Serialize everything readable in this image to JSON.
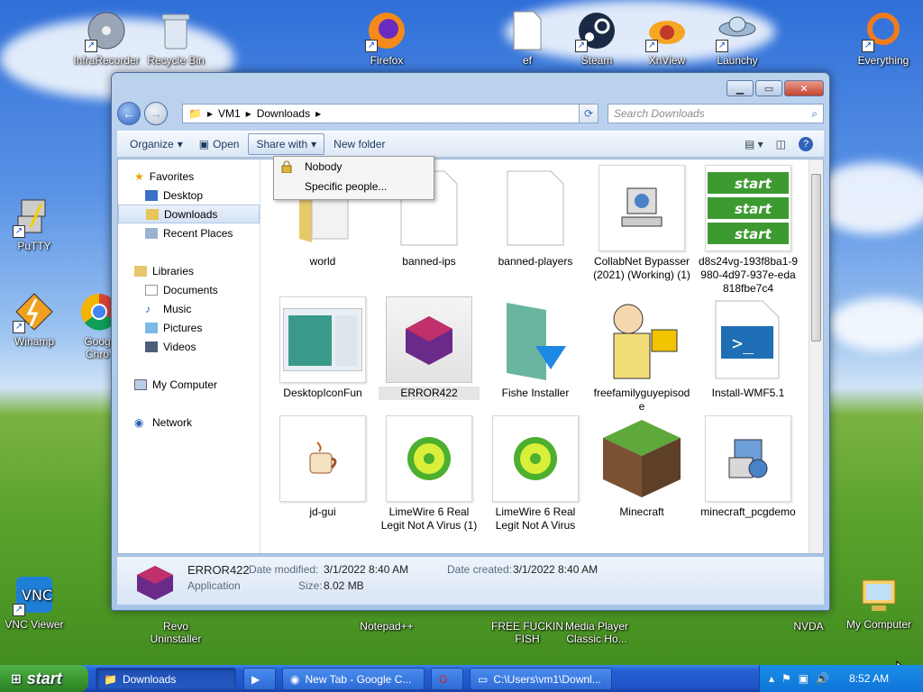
{
  "desktop": {
    "icons": [
      {
        "label": "InfraRecorder",
        "icon": "cd-icon"
      },
      {
        "label": "Recycle Bin",
        "icon": "trash-icon"
      },
      {
        "label": "Firefox",
        "icon": "firefox-icon"
      },
      {
        "label": "ef",
        "icon": "document-icon"
      },
      {
        "label": "Steam",
        "icon": "steam-icon"
      },
      {
        "label": "XnView",
        "icon": "xnview-icon"
      },
      {
        "label": "Launchy",
        "icon": "launchy-icon"
      },
      {
        "label": "Everything",
        "icon": "search-icon"
      },
      {
        "label": "PuTTY",
        "icon": "putty-icon"
      },
      {
        "label": "Winamp",
        "icon": "winamp-icon"
      },
      {
        "label": "Goog Chro",
        "icon": "chrome-icon"
      },
      {
        "label": "VNC Viewer",
        "icon": "vnc-icon"
      },
      {
        "label": "Revo Uninstaller",
        "icon": "revo-icon"
      },
      {
        "label": "Notepad++",
        "icon": "notepad-icon"
      },
      {
        "label": "FREE FUCKIN FISH",
        "icon": "fish-icon"
      },
      {
        "label": "Media Player Classic Ho...",
        "icon": "media-player-icon"
      },
      {
        "label": "NVDA",
        "icon": "nvda-icon"
      },
      {
        "label": "My Computer",
        "icon": "computer-icon"
      }
    ]
  },
  "window": {
    "breadcrumb": [
      "VM1",
      "Downloads"
    ],
    "search_placeholder": "Search Downloads",
    "toolbar": {
      "organize": "Organize",
      "open": "Open",
      "share_with": "Share with",
      "new_folder": "New folder"
    },
    "share_menu": [
      "Nobody",
      "Specific people..."
    ],
    "nav": {
      "favorites": "Favorites",
      "desktop": "Desktop",
      "downloads": "Downloads",
      "recent_places": "Recent Places",
      "libraries": "Libraries",
      "documents": "Documents",
      "music": "Music",
      "pictures": "Pictures",
      "videos": "Videos",
      "my_computer": "My Computer",
      "network": "Network"
    },
    "files": [
      {
        "name": "world",
        "icon": "folder-icon"
      },
      {
        "name": "banned-ips",
        "icon": "document-icon"
      },
      {
        "name": "banned-players",
        "icon": "document-icon"
      },
      {
        "name": "CollabNet Bypasser (2021) (Working) (1)",
        "icon": "computer-icon"
      },
      {
        "name": "d8s24vg-193f8ba1-9980-4d97-937e-eda818fbe7c4",
        "icon": "start-buttons-icon"
      },
      {
        "name": "DesktopIconFun",
        "icon": "window-thumb-icon"
      },
      {
        "name": "ERROR422",
        "icon": "cube-icon"
      },
      {
        "name": "Fishe Installer",
        "icon": "installer-icon"
      },
      {
        "name": "freefamilyguyepisode",
        "icon": "cartoon-icon"
      },
      {
        "name": "Install-WMF5.1",
        "icon": "powershell-icon"
      },
      {
        "name": "jd-gui",
        "icon": "java-icon"
      },
      {
        "name": "LimeWire 6 Real Legit Not A Virus (1)",
        "icon": "limewire-icon"
      },
      {
        "name": "LimeWire 6 Real Legit Not A Virus",
        "icon": "limewire-icon"
      },
      {
        "name": "Minecraft",
        "icon": "grass-block-icon"
      },
      {
        "name": "minecraft_pcgdemo",
        "icon": "setup-icon"
      }
    ],
    "details": {
      "name": "ERROR422",
      "type": "Application",
      "date_modified_label": "Date modified:",
      "date_modified": "3/1/2022 8:40 AM",
      "date_created_label": "Date created:",
      "date_created": "3/1/2022 8:40 AM",
      "size_label": "Size:",
      "size": "8.02 MB"
    }
  },
  "taskbar": {
    "start": "start",
    "tasks": [
      {
        "label": "Downloads"
      },
      {
        "label": ""
      },
      {
        "label": "New Tab - Google C..."
      },
      {
        "label": ""
      },
      {
        "label": "C:\\Users\\vm1\\Downl..."
      }
    ],
    "clock": "8:52 AM"
  }
}
